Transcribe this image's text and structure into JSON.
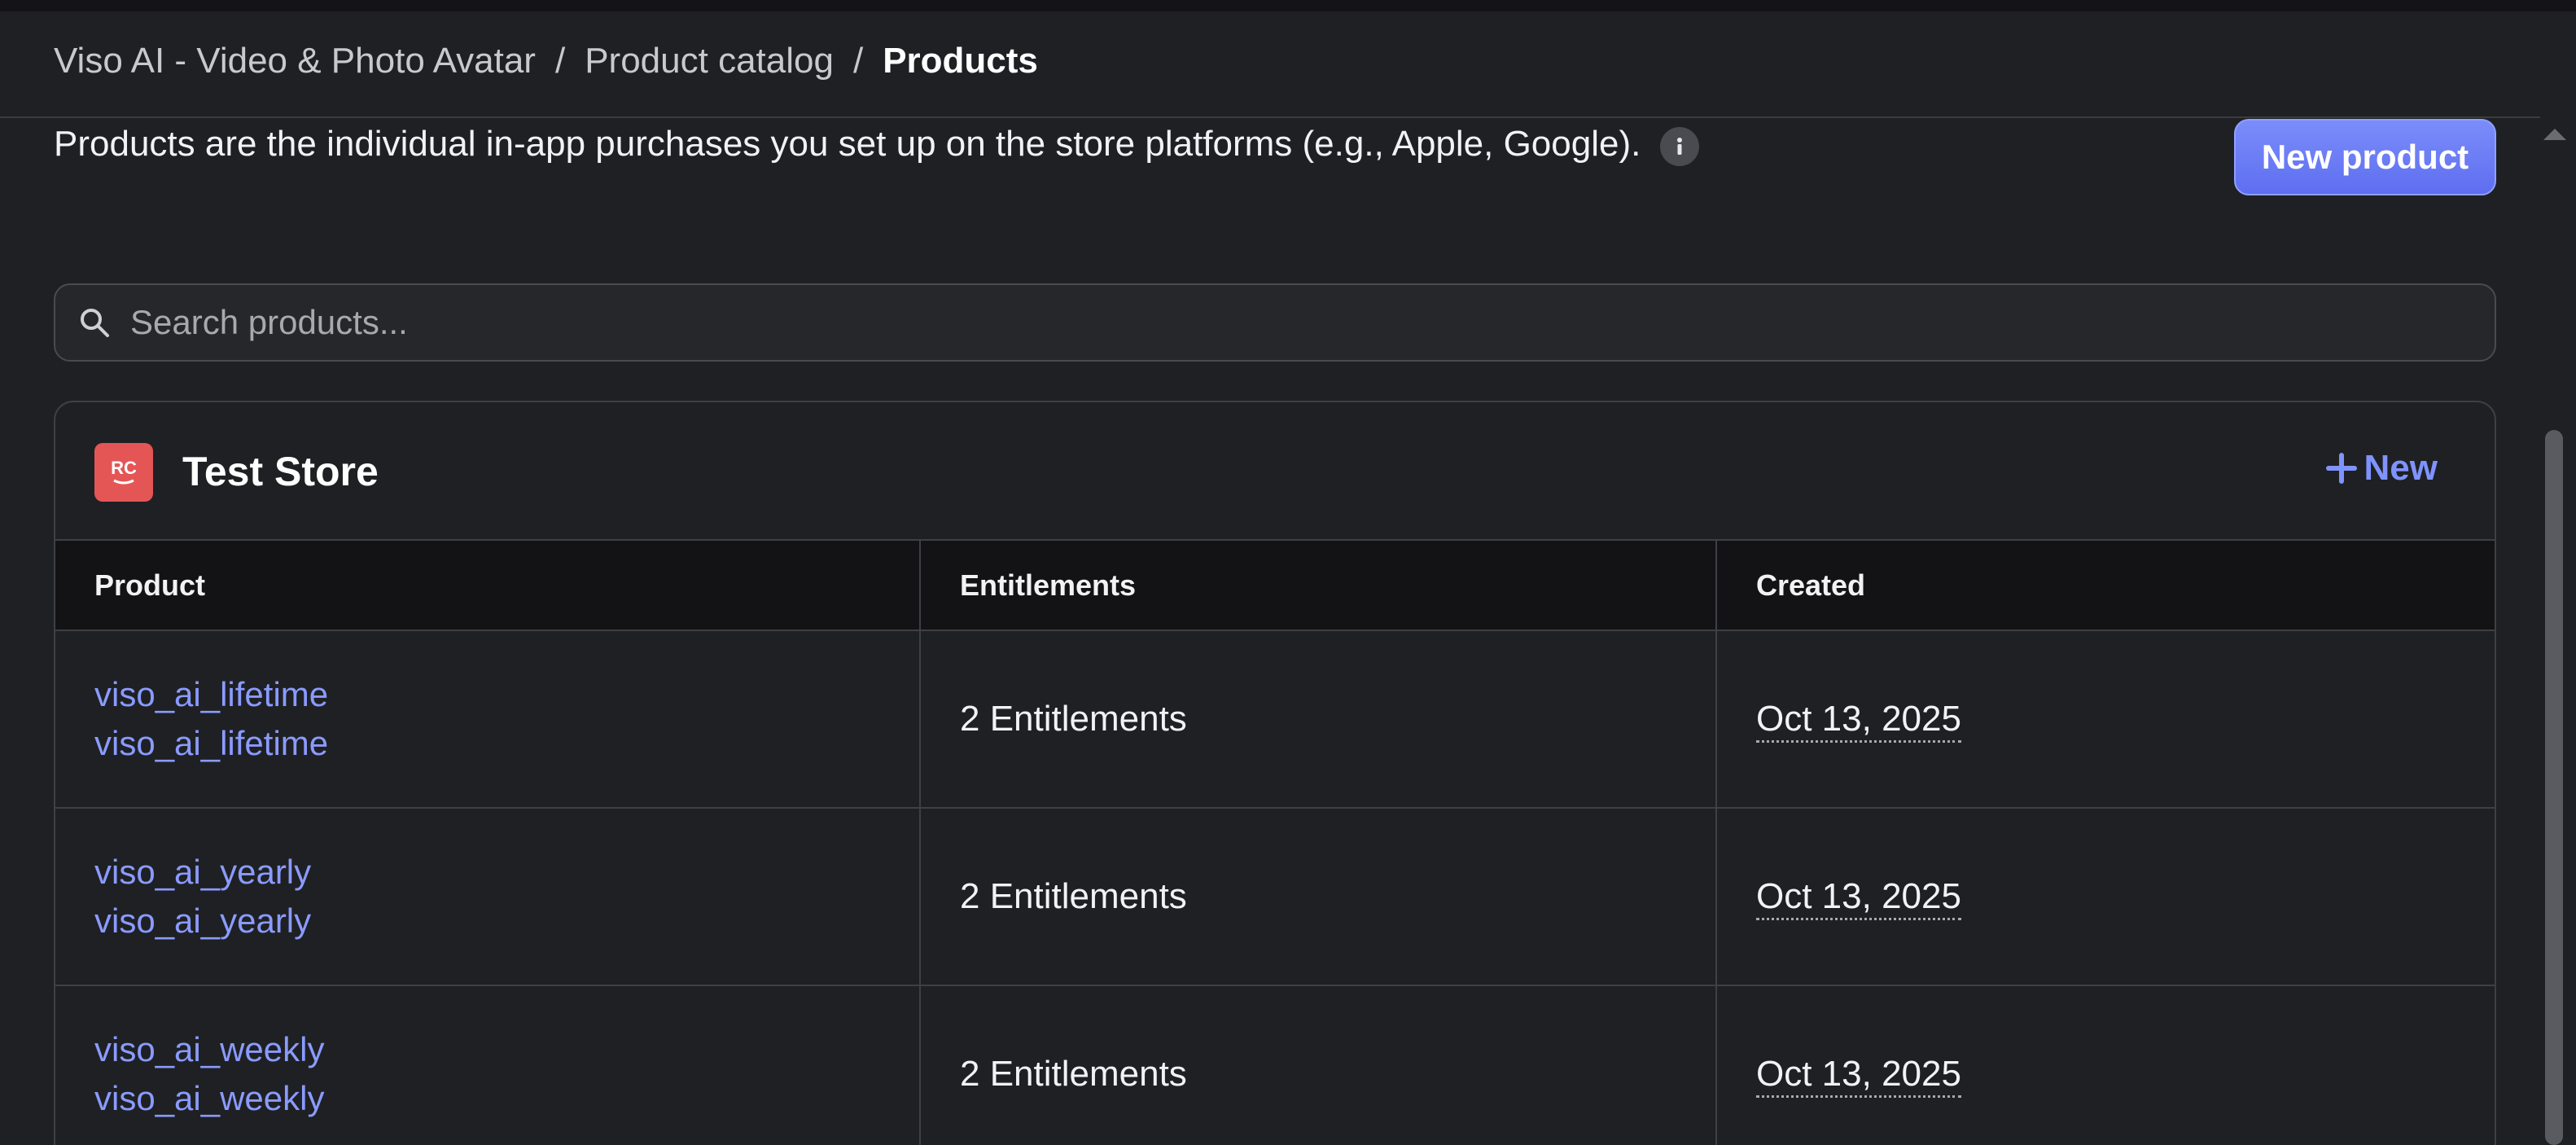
{
  "breadcrumb": {
    "app": "Viso AI - Video & Photo Avatar",
    "separator": "/",
    "section": "Product catalog",
    "current": "Products"
  },
  "description": "Products are the individual in-app purchases you set up on the store platforms (e.g., Apple, Google).",
  "new_product_label": "New product",
  "search": {
    "placeholder": "Search products...",
    "value": ""
  },
  "store": {
    "logo_text": "RC",
    "name": "Test Store",
    "new_label": "New"
  },
  "table": {
    "columns": [
      "Product",
      "Entitlements",
      "Created"
    ],
    "rows": [
      {
        "identifier": "viso_ai_lifetime",
        "store_id": "viso_ai_lifetime",
        "entitlements": "2 Entitlements",
        "created": "Oct 13, 2025"
      },
      {
        "identifier": "viso_ai_yearly",
        "store_id": "viso_ai_yearly",
        "entitlements": "2 Entitlements",
        "created": "Oct 13, 2025"
      },
      {
        "identifier": "viso_ai_weekly",
        "store_id": "viso_ai_weekly",
        "entitlements": "2 Entitlements",
        "created": "Oct 13, 2025"
      }
    ]
  },
  "colors": {
    "background": "#1f2023",
    "accent": "#6b7cf6",
    "link": "#8a9bff",
    "store_logo": "#e45656"
  },
  "icons": {
    "info": "info-icon",
    "search": "search-icon",
    "plus": "plus-icon"
  }
}
